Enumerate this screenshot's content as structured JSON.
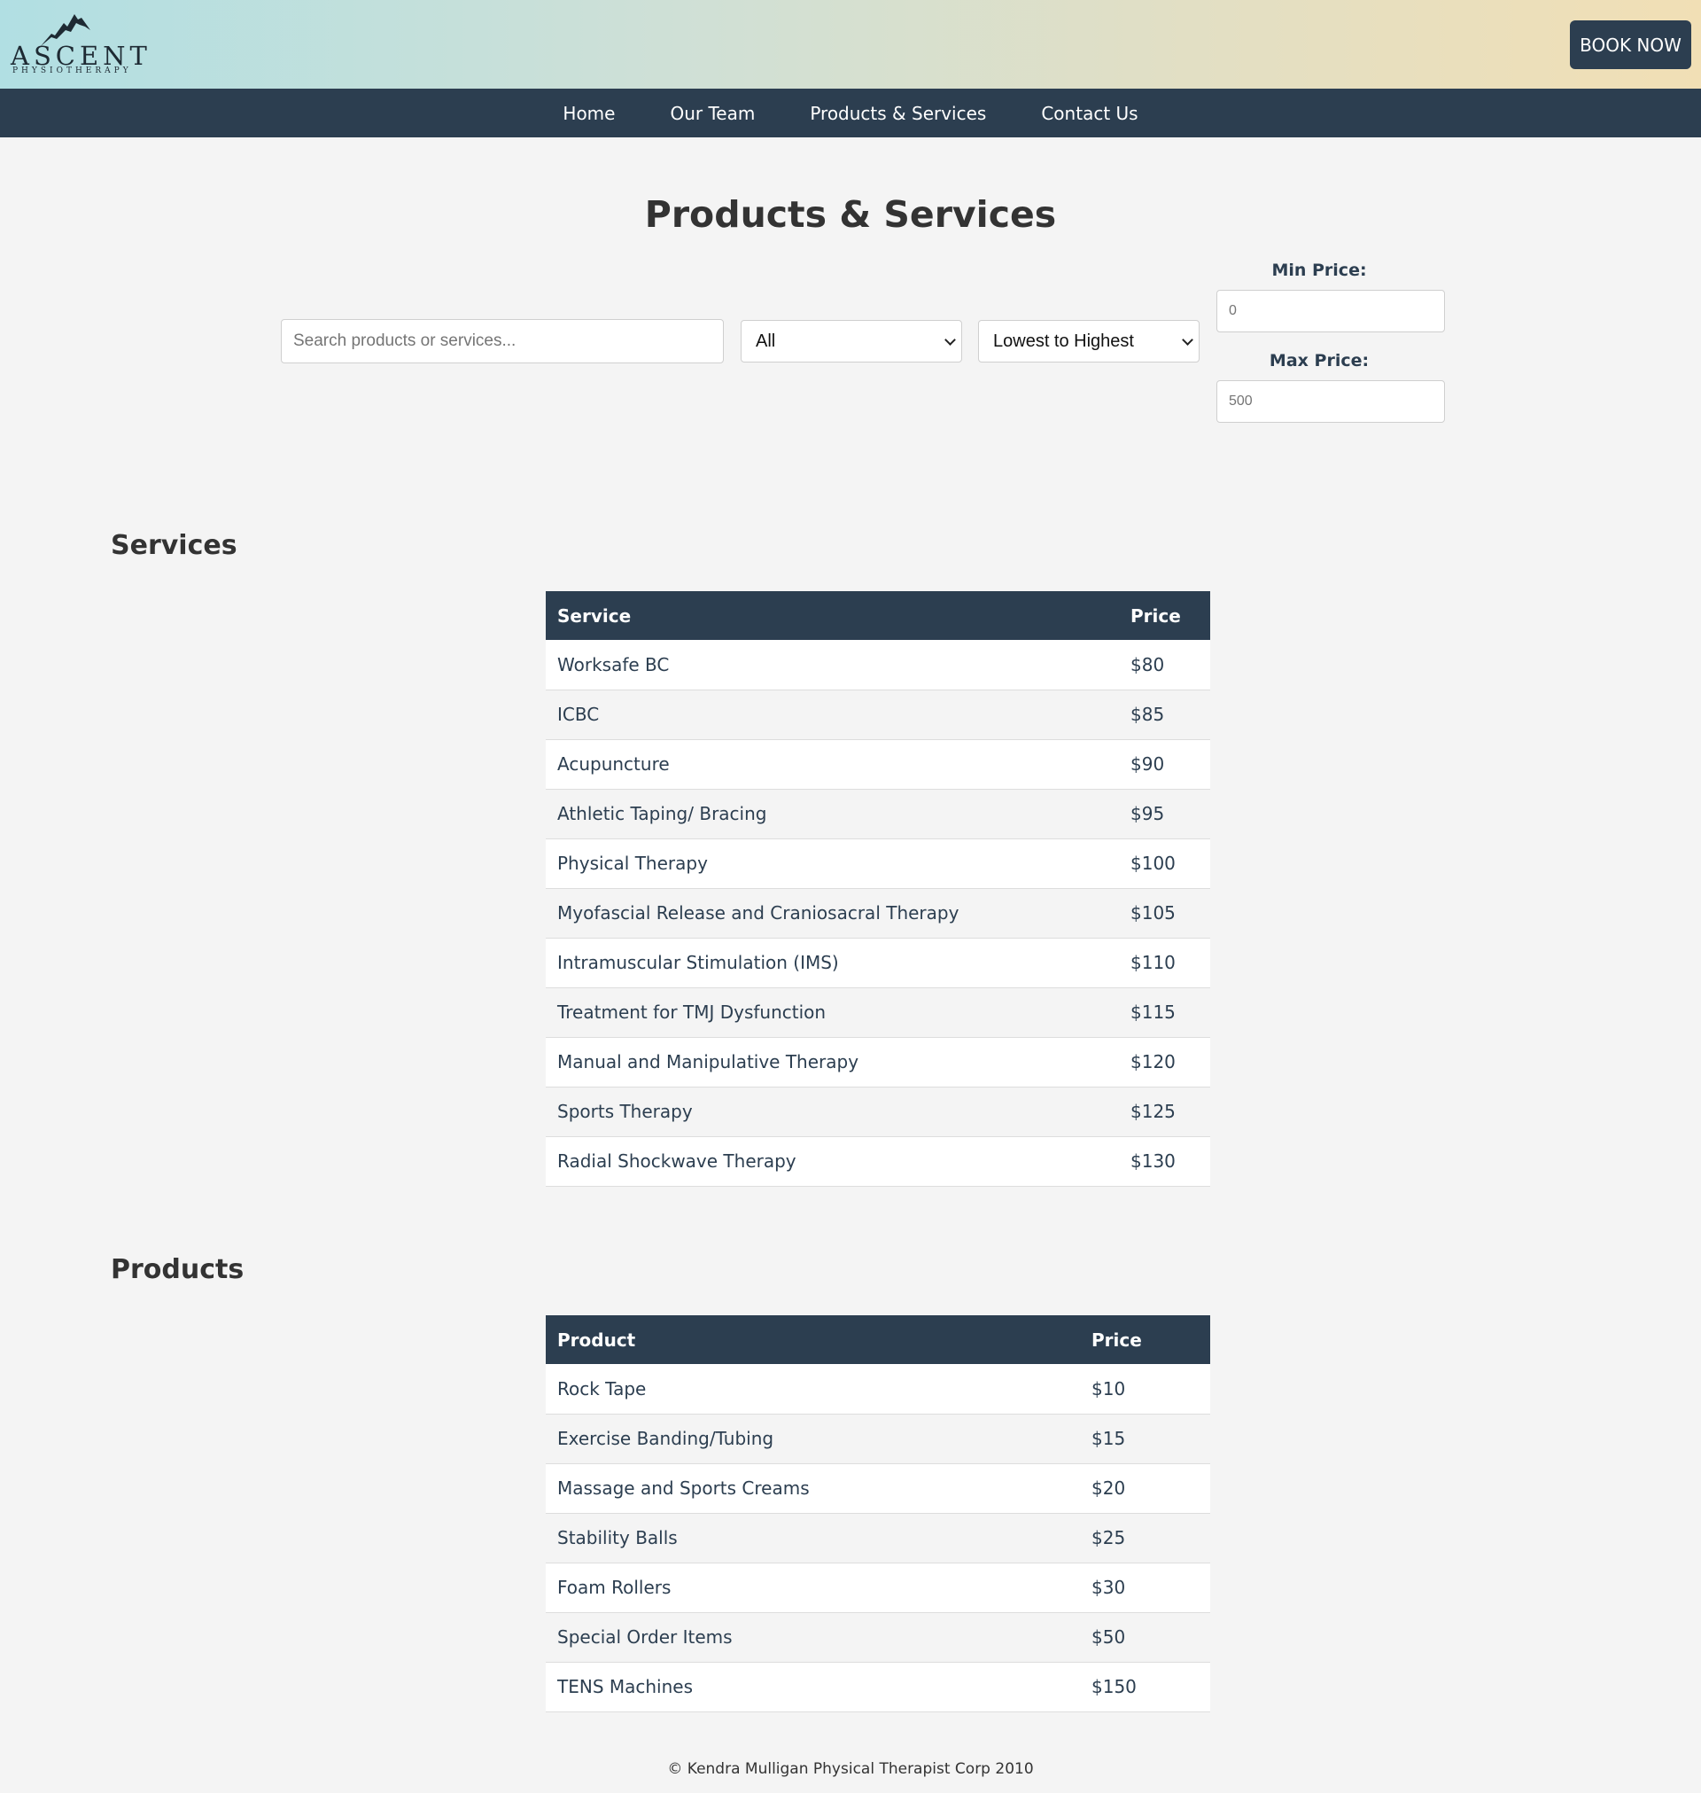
{
  "header": {
    "logo_main": "ASCENT",
    "logo_sub": "PHYSIOTHERAPY",
    "book_label": "BOOK NOW"
  },
  "nav": {
    "items": [
      {
        "label": "Home"
      },
      {
        "label": "Our Team"
      },
      {
        "label": "Products & Services"
      },
      {
        "label": "Contact Us"
      }
    ]
  },
  "page": {
    "title": "Products & Services"
  },
  "filters": {
    "search_placeholder": "Search products or services...",
    "type_selected": "All",
    "sort_selected": "Lowest to Highest",
    "min_label": "Min Price:",
    "min_placeholder": "0",
    "max_label": "Max Price:",
    "max_placeholder": "500"
  },
  "services": {
    "title": "Services",
    "col_name": "Service",
    "col_price": "Price",
    "rows": [
      {
        "name": "Worksafe BC",
        "price": "$80"
      },
      {
        "name": "ICBC",
        "price": "$85"
      },
      {
        "name": "Acupuncture",
        "price": "$90"
      },
      {
        "name": "Athletic Taping/ Bracing",
        "price": "$95"
      },
      {
        "name": "Physical Therapy",
        "price": "$100"
      },
      {
        "name": "Myofascial Release and Craniosacral Therapy",
        "price": "$105"
      },
      {
        "name": "Intramuscular Stimulation (IMS)",
        "price": "$110"
      },
      {
        "name": "Treatment for TMJ Dysfunction",
        "price": "$115"
      },
      {
        "name": "Manual and Manipulative Therapy",
        "price": "$120"
      },
      {
        "name": "Sports Therapy",
        "price": "$125"
      },
      {
        "name": "Radial Shockwave Therapy",
        "price": "$130"
      }
    ]
  },
  "products": {
    "title": "Products",
    "col_name": "Product",
    "col_price": "Price",
    "rows": [
      {
        "name": "Rock Tape",
        "price": "$10"
      },
      {
        "name": "Exercise Banding/Tubing",
        "price": "$15"
      },
      {
        "name": "Massage and Sports Creams",
        "price": "$20"
      },
      {
        "name": "Stability Balls",
        "price": "$25"
      },
      {
        "name": "Foam Rollers",
        "price": "$30"
      },
      {
        "name": "Special Order Items",
        "price": "$50"
      },
      {
        "name": "TENS Machines",
        "price": "$150"
      }
    ]
  },
  "footer": {
    "text": "© Kendra Mulligan Physical Therapist Corp 2010"
  }
}
